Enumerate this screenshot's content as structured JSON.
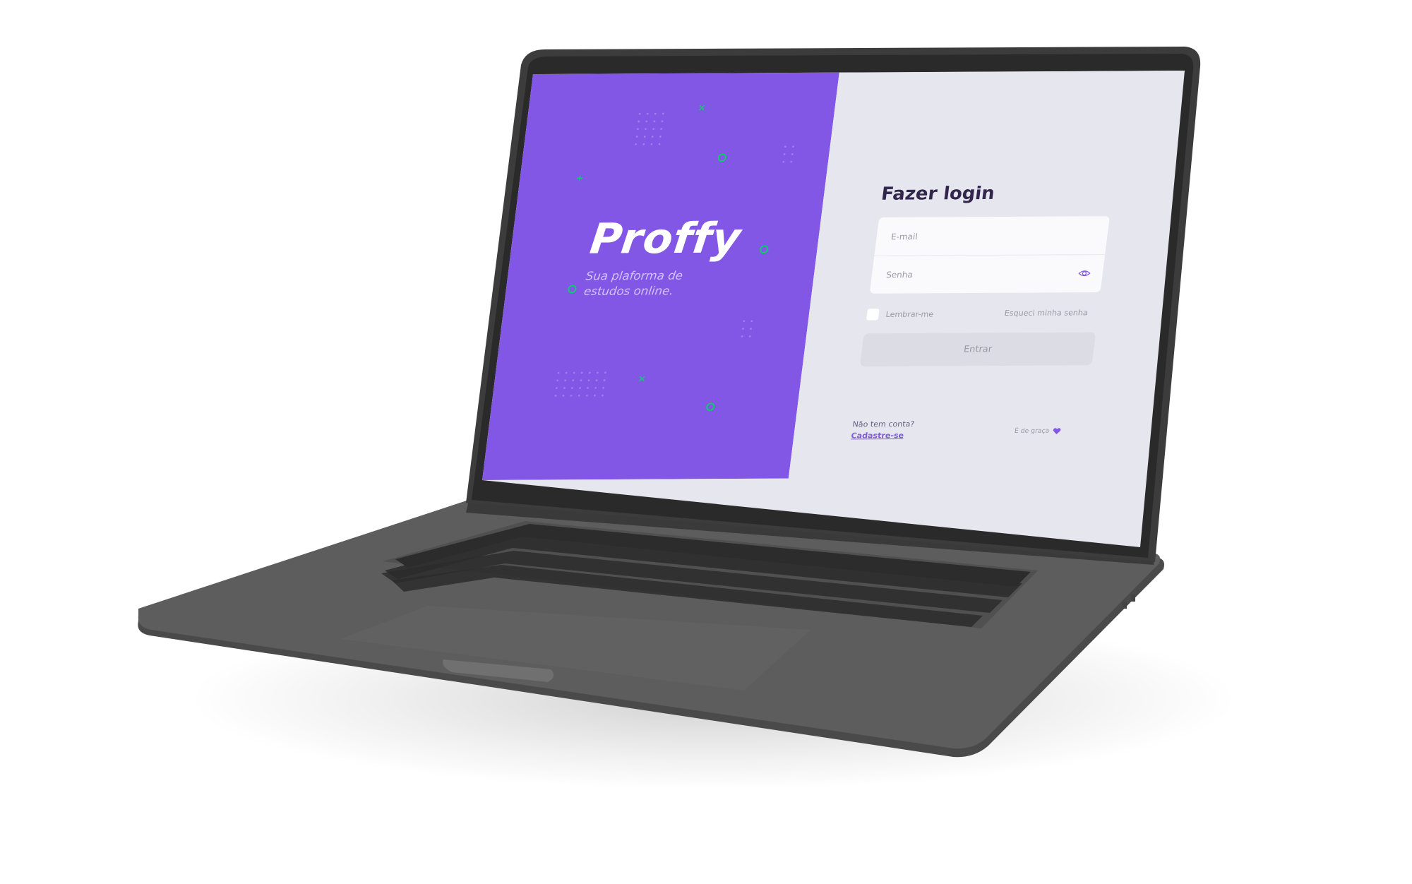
{
  "brand": {
    "logo": "Proffy",
    "tagline": "Sua plaforma de estudos online.",
    "background_color": "#8257e5",
    "accent_color": "#04d361"
  },
  "login": {
    "title": "Fazer login",
    "email_placeholder": "E-mail",
    "password_placeholder": "Senha",
    "remember_label": "Lembrar-me",
    "forgot_label": "Esqueci minha senha",
    "submit_label": "Entrar",
    "no_account_label": "Não tem conta?",
    "signup_label": "Cadastre-se",
    "free_label": "É de graça",
    "icons": {
      "password_toggle": "eye-icon",
      "free": "heart-icon"
    }
  },
  "device": {
    "type": "laptop",
    "body_color": "#5f5f5f"
  }
}
